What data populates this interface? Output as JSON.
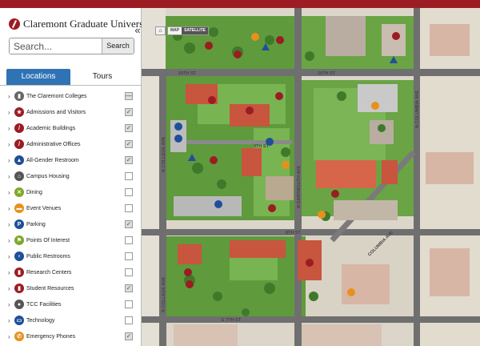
{
  "brand": {
    "name": "Claremont Graduate University",
    "color": "#9b1c22"
  },
  "collapse_icon": "«",
  "search": {
    "placeholder": "Search...",
    "button": "Search"
  },
  "tabs": [
    {
      "label": "Locations",
      "active": true
    },
    {
      "label": "Tours",
      "active": false
    }
  ],
  "categories": [
    {
      "label": "The Claremont Colleges",
      "icon": "building-icon",
      "color": "#666666",
      "glyph": "▮",
      "state": "partial"
    },
    {
      "label": "Admissions and Visitors",
      "icon": "star-icon",
      "color": "#9b1c22",
      "glyph": "★",
      "state": "checked"
    },
    {
      "label": "Academic Buildings",
      "icon": "cgu-logo-icon",
      "color": "#9b1c22",
      "glyph": "/",
      "state": "checked"
    },
    {
      "label": "Administrative Offices",
      "icon": "cgu-logo-icon",
      "color": "#9b1c22",
      "glyph": "/",
      "state": "checked"
    },
    {
      "label": "All-Gender Restroom",
      "icon": "triangle-icon",
      "color": "#1f4f99",
      "glyph": "▲",
      "state": "checked"
    },
    {
      "label": "Campus Housing",
      "icon": "house-icon",
      "color": "#555555",
      "glyph": "⌂",
      "state": "unchecked"
    },
    {
      "label": "Dining",
      "icon": "fork-knife-icon",
      "color": "#7fa82a",
      "glyph": "✕",
      "state": "unchecked"
    },
    {
      "label": "Event Venues",
      "icon": "ticket-icon",
      "color": "#e8901c",
      "glyph": "▬",
      "state": "unchecked"
    },
    {
      "label": "Parking",
      "icon": "parking-icon",
      "color": "#1f4f99",
      "glyph": "P",
      "state": "checked"
    },
    {
      "label": "Points Of Interest",
      "icon": "flag-icon",
      "color": "#7fa82a",
      "glyph": "⚑",
      "state": "unchecked"
    },
    {
      "label": "Public Restrooms",
      "icon": "restroom-icon",
      "color": "#1f4f99",
      "glyph": "♀",
      "state": "unchecked"
    },
    {
      "label": "Research Centers",
      "icon": "book-icon",
      "color": "#9b1c22",
      "glyph": "▮",
      "state": "unchecked"
    },
    {
      "label": "Student Resources",
      "icon": "book-icon",
      "color": "#9b1c22",
      "glyph": "▮",
      "state": "checked"
    },
    {
      "label": "TCC Facilities",
      "icon": "tcc-icon",
      "color": "#555555",
      "glyph": "●",
      "state": "unchecked"
    },
    {
      "label": "Technology",
      "icon": "laptop-icon",
      "color": "#1f4f99",
      "glyph": "▭",
      "state": "unchecked"
    },
    {
      "label": "Emergency Phones",
      "icon": "phone-icon",
      "color": "#e8901c",
      "glyph": "✆",
      "state": "checked"
    }
  ],
  "map_controls": {
    "home": "⌂",
    "map": "MAP",
    "satellite": "SATELLITE",
    "active": "SATELLITE"
  },
  "streets": {
    "tenth_a": "10TH ST",
    "tenth_b": "10TH ST",
    "ninth": "9TH ST",
    "eighth": "8TH ST",
    "seventh": "E 7TH ST",
    "college": "N COLLEGE AVE",
    "college_b": "N COLLEGE AVE",
    "dartmouth": "N DARTMOUTH AVE",
    "columbia": "N COLUMBIA AVE",
    "columbia_b": "COLUMBIA AVE"
  }
}
